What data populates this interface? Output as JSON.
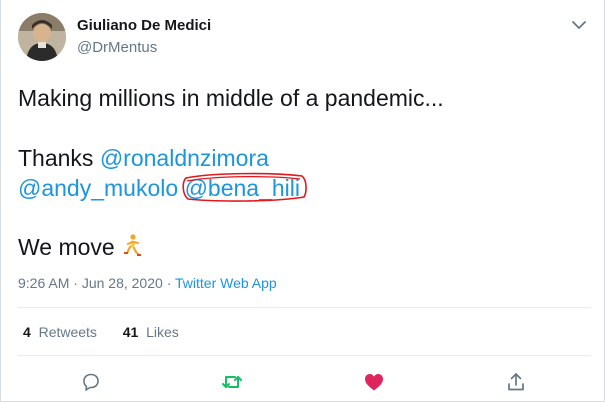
{
  "author": {
    "name": "Giuliano De Medici",
    "handle": "@DrMentus"
  },
  "tweet": {
    "line1": "Making millions in middle of a pandemic...",
    "thanks_word": "Thanks",
    "mention1": "@ronaldnzimora",
    "mention2": "@andy_mukolo",
    "mention3": "@bena_hili",
    "line3": "We move",
    "emoji_icon": "person-running-icon"
  },
  "meta": {
    "time": "9:26 AM",
    "separator": "·",
    "date": "Jun 28, 2020",
    "source": "Twitter Web App"
  },
  "stats": {
    "retweets_count": "4",
    "retweets_label": "Retweets",
    "likes_count": "41",
    "likes_label": "Likes"
  },
  "colors": {
    "link": "#1b95e0",
    "retweet_active": "#17bf63",
    "like_active": "#e0245e",
    "annotation": "#e0191b"
  },
  "actions": [
    "reply-icon",
    "retweet-icon",
    "like-icon",
    "share-icon"
  ]
}
